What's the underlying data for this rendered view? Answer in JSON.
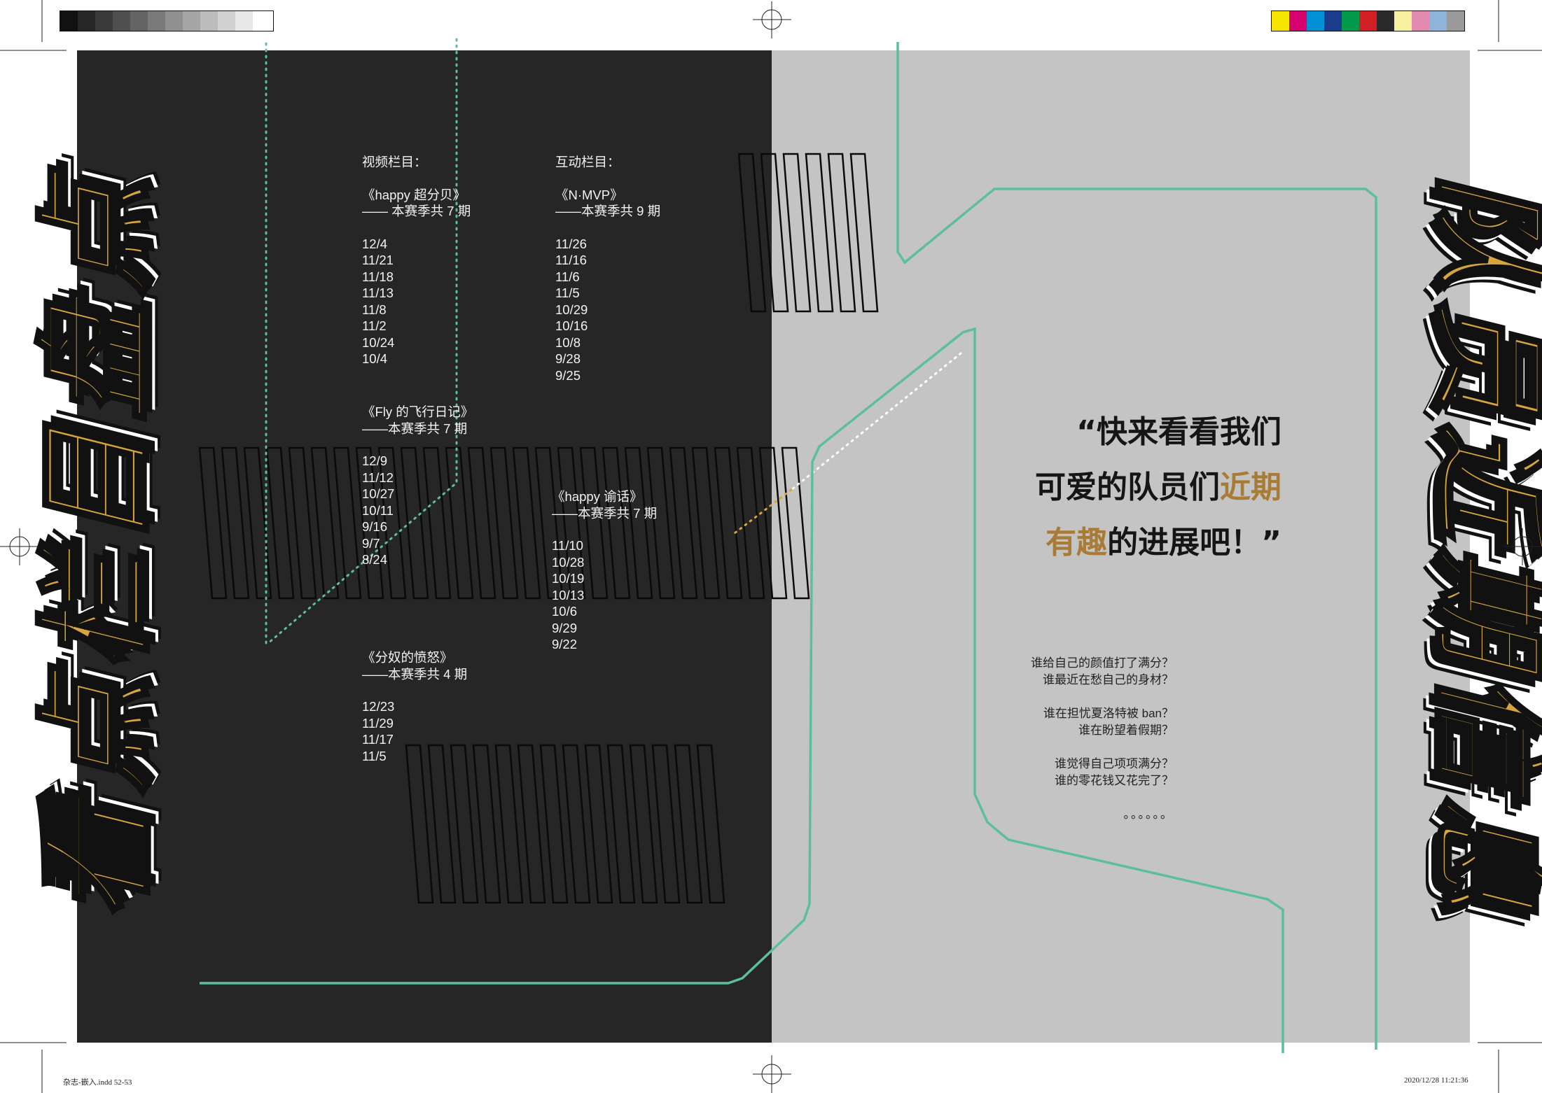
{
  "titles": {
    "left": "看点栏目盘点",
    "right": "队员近期信息"
  },
  "video_section": {
    "heading": "视频栏目：",
    "programs": [
      {
        "name": "《happy 超分贝》",
        "episodes": "—— 本赛季共 7 期",
        "dates": [
          "12/4",
          "11/21",
          "11/18",
          "11/13",
          "11/8",
          "11/2",
          "10/24",
          "10/4"
        ]
      },
      {
        "name": "《Fly 的飞行日记》",
        "episodes": "——本赛季共 7 期",
        "dates": [
          "12/9",
          "11/12",
          "10/27",
          "10/11",
          "9/16",
          "9/7",
          "8/24"
        ]
      },
      {
        "name": "《分奴的愤怒》",
        "episodes": "——本赛季共 4 期",
        "dates": [
          "12/23",
          "11/29",
          "11/17",
          "11/5"
        ]
      }
    ]
  },
  "interactive_section": {
    "heading": "互动栏目：",
    "programs": [
      {
        "name": "《N·MVP》",
        "episodes": "——本赛季共 9 期",
        "dates": [
          "11/26",
          "11/16",
          "11/6",
          "11/5",
          "10/29",
          "10/16",
          "10/8",
          "9/28",
          "9/25"
        ]
      },
      {
        "name": "《happy 谕话》",
        "episodes": "——本赛季共 7 期",
        "dates": [
          "11/10",
          "10/28",
          "10/19",
          "10/13",
          "10/6",
          "9/29",
          "9/22"
        ]
      }
    ]
  },
  "quote": {
    "line1": "“快来看看我们",
    "line2_a": "可爱的队员们",
    "line2_b": "近期",
    "line3_a": "有趣",
    "line3_b": "的进展吧！”"
  },
  "questions": [
    [
      "谁给自己的颜值打了满分？",
      "谁最近在愁自己的身材？"
    ],
    [
      "谁在担忧夏洛特被 ban？",
      "谁在盼望着假期？"
    ],
    [
      "谁觉得自己项项满分？",
      "谁的零花钱又花完了？"
    ]
  ],
  "ellipsis": "。。。。。。",
  "print_marks": {
    "file_label": "杂志-嵌入.indd   52-53",
    "timestamp": "2020/12/28   11:21:36"
  },
  "colors": {
    "gold": "#d6a63c",
    "accent_brown": "#a87c36",
    "green_line": "#5dbf9a",
    "dark_panel": "#262626",
    "light_panel": "#c4c4c4"
  }
}
